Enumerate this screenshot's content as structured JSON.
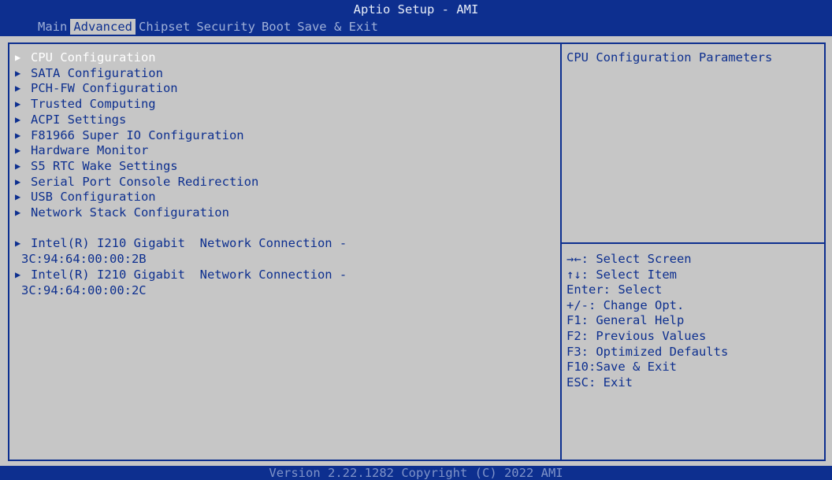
{
  "app": {
    "title": "Aptio Setup - AMI",
    "footer": "Version 2.22.1282 Copyright (C) 2022 AMI"
  },
  "tabs": [
    {
      "label": "Main",
      "active": false
    },
    {
      "label": "Advanced",
      "active": true
    },
    {
      "label": "Chipset",
      "active": false
    },
    {
      "label": "Security",
      "active": false
    },
    {
      "label": "Boot",
      "active": false
    },
    {
      "label": "Save & Exit",
      "active": false
    }
  ],
  "menu": {
    "items": [
      {
        "label": "CPU Configuration",
        "selected": true
      },
      {
        "label": "SATA Configuration"
      },
      {
        "label": "PCH-FW Configuration"
      },
      {
        "label": "Trusted Computing"
      },
      {
        "label": "ACPI Settings"
      },
      {
        "label": "F81966 Super IO Configuration"
      },
      {
        "label": "Hardware Monitor"
      },
      {
        "label": "S5 RTC Wake Settings"
      },
      {
        "label": "Serial Port Console Redirection"
      },
      {
        "label": "USB Configuration"
      },
      {
        "label": "Network Stack Configuration"
      }
    ],
    "network": [
      {
        "line1": "Intel(R) I210 Gigabit  Network Connection -",
        "line2": "3C:94:64:00:00:2B"
      },
      {
        "line1": "Intel(R) I210 Gigabit  Network Connection -",
        "line2": "3C:94:64:00:00:2C"
      }
    ]
  },
  "help": {
    "description": "CPU Configuration Parameters",
    "keys": [
      "→←: Select Screen",
      "↑↓: Select Item",
      "Enter: Select",
      "+/-: Change Opt.",
      "F1: General Help",
      "F2: Previous Values",
      "F3: Optimized Defaults",
      "F10:Save & Exit",
      "ESC: Exit"
    ]
  },
  "colors": {
    "background": "#c6c6c6",
    "accent": "#0d2f8f",
    "selected_text": "#ffffff"
  },
  "icons": {
    "submenu": "triangle-right-icon"
  }
}
